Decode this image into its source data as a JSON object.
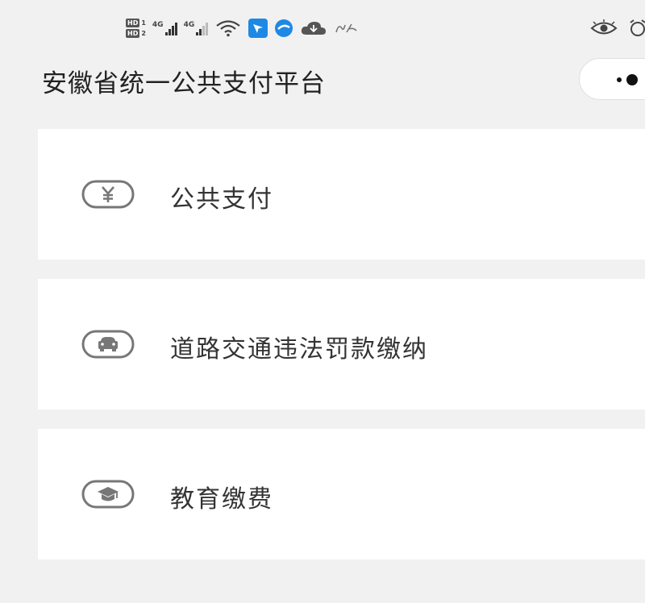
{
  "status_bar": {
    "sim_badge": "HD",
    "sim1_num": "1",
    "sim2_num": "2",
    "network1": "4G",
    "network2": "4G"
  },
  "header": {
    "title": "安徽省统一公共支付平台"
  },
  "menu": {
    "items": [
      {
        "label": "公共支付",
        "icon": "yuan-icon"
      },
      {
        "label": "道路交通违法罚款缴纳",
        "icon": "car-icon"
      },
      {
        "label": "教育缴费",
        "icon": "graduation-cap-icon"
      }
    ]
  },
  "colors": {
    "background": "#f1f1f1",
    "card": "#ffffff",
    "icon_stroke": "#777777",
    "text": "#333333"
  }
}
